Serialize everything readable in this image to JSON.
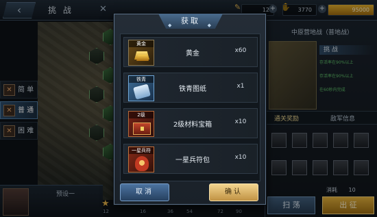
{
  "background": {
    "top_bar": {
      "title": "挑 战",
      "close_glyph": "✕",
      "resources": [
        {
          "icon": "stamina-icon",
          "value": "12"
        },
        {
          "icon": "coin-icon",
          "value": "3770"
        },
        {
          "icon": "gold-ingot-icon",
          "value": "95000"
        }
      ]
    },
    "difficulties": [
      {
        "label": "简 单",
        "active": false
      },
      {
        "label": "普 通",
        "active": true
      },
      {
        "label": "困 难",
        "active": false
      }
    ],
    "preset_label": "预设一",
    "axis_numbers": [
      "12",
      "16",
      "36",
      "54",
      "72",
      "90"
    ],
    "right_panel": {
      "location": "中原营地战（普地战）",
      "challenge_label": "挑 战",
      "objectives": [
        "存活率在90%以上",
        "存活率在90%以上",
        "在60秒内完成"
      ],
      "tabs": [
        {
          "label": "通关奖励",
          "active": true
        },
        {
          "label": "敌军信息",
          "active": false
        }
      ],
      "cost_label": "消耗",
      "cost_value": "10",
      "sweep_label": "扫 荡",
      "go_label": "出 征"
    }
  },
  "modal": {
    "title": "获取",
    "items": [
      {
        "name": "黄金",
        "qty": "x60",
        "tag": "黄金",
        "icon": "gold-ingot-icon",
        "style": "gold"
      },
      {
        "name": "铁青图纸",
        "qty": "x1",
        "tag": "铁青",
        "icon": "blueprint-scroll-icon",
        "style": "blue"
      },
      {
        "name": "2级材料宝箱",
        "qty": "x10",
        "tag": "2级",
        "icon": "treasure-chest-icon",
        "style": "red"
      },
      {
        "name": "一星兵符包",
        "qty": "x10",
        "tag": "一星兵符",
        "icon": "army-token-icon",
        "style": "red2"
      }
    ],
    "cancel_label": "取消",
    "confirm_label": "确认"
  },
  "colors": {
    "accent_blue": "#4c73a0",
    "accent_gold": "#f3d58f",
    "panel_bg": "#1a2129"
  }
}
